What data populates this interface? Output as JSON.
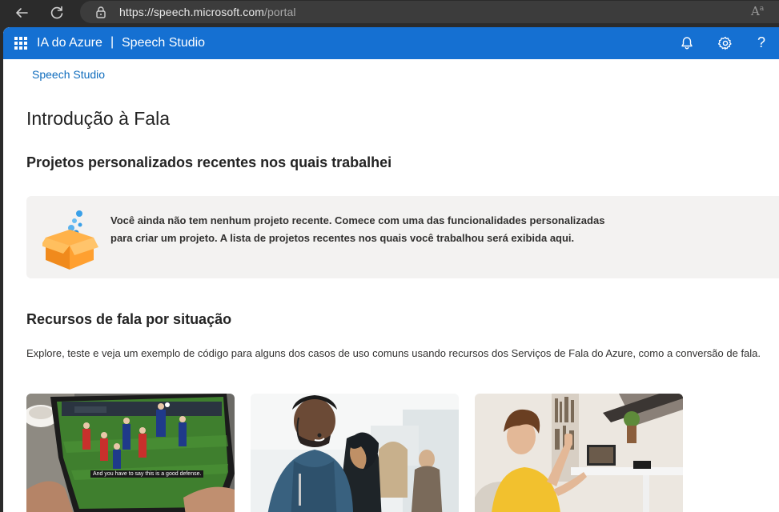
{
  "browser": {
    "url_host": "https://speech.microsoft.com",
    "url_path": "/portal",
    "read_aloud_icon": "Aᵃ"
  },
  "header": {
    "brand": "IA do Azure",
    "separator": "|",
    "product": "Speech Studio",
    "help_label": "?"
  },
  "breadcrumb": "Speech Studio",
  "page_title": "Introdução à Fala",
  "recent_projects": {
    "title": "Projetos personalizados recentes nos quais trabalhei",
    "empty_message": "Você ainda não tem nenhum projeto recente. Comece com uma das funcionalidades personalizadas para criar um projeto. A lista de projetos recentes nos quais você trabalhou será exibida aqui."
  },
  "scenarios": {
    "title": "Recursos de fala por situação",
    "description": "Explore, teste e veja um exemplo de código para alguns dos casos de uso comuns usando recursos dos Serviços de Fala do Azure, como a conversão de fala.",
    "cards": [
      {
        "name": "captioning-card",
        "caption": "And you have to say this is a good defense."
      },
      {
        "name": "call-center-card"
      },
      {
        "name": "voice-assistant-card"
      }
    ]
  },
  "colors": {
    "azure_blue": "#1570d2",
    "link": "#0f6cbd",
    "card_bg": "#f3f2f1"
  }
}
